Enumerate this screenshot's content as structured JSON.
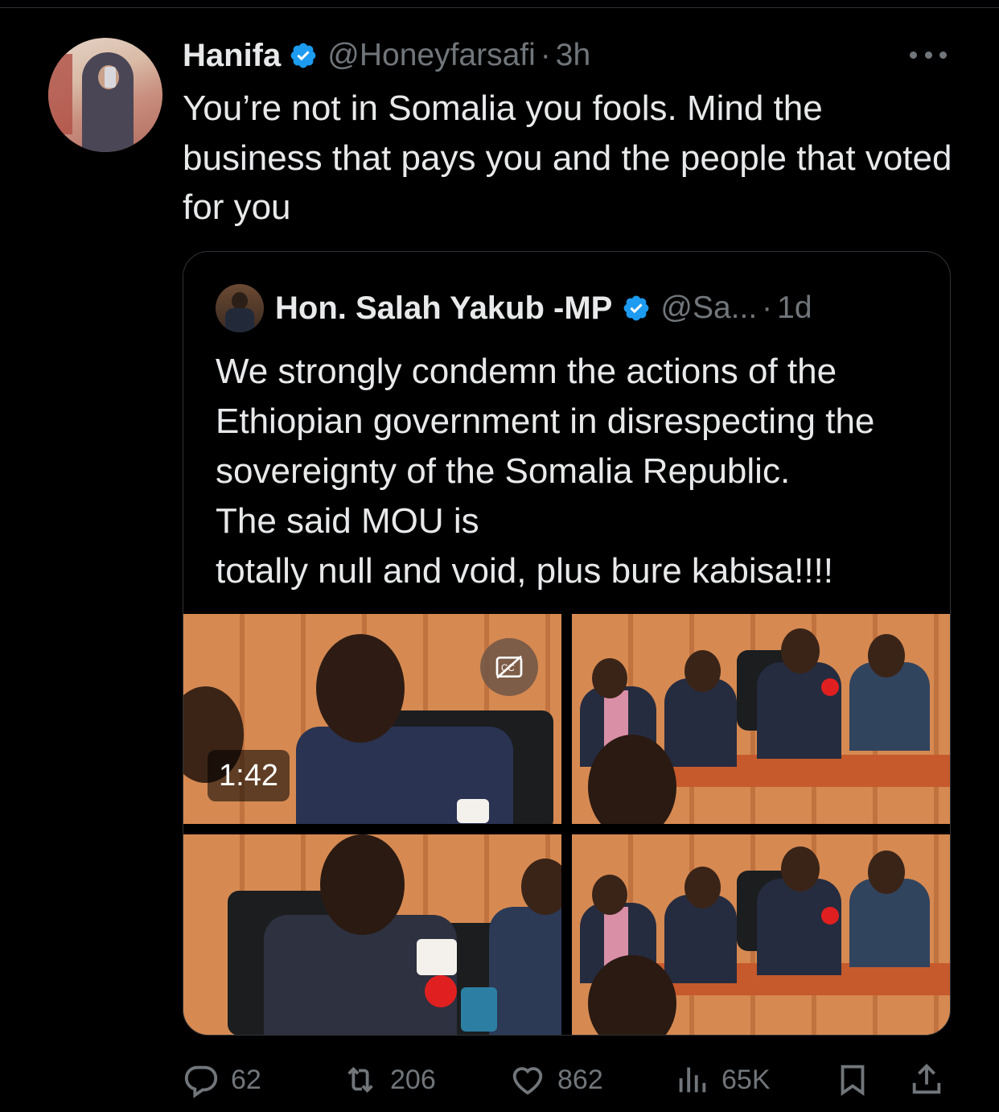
{
  "tweet": {
    "author_name": "Hanifa",
    "handle": "@Honeyfarsafi",
    "separator": "·",
    "time": "3h",
    "text": "You’re not in Somalia you fools. Mind the business that pays you and the people that voted for you",
    "avatar_icon": "user-avatar-photo",
    "verified_icon": "verified-badge-icon",
    "more_icon": "more-options-icon"
  },
  "quoted_tweet": {
    "author_name": "Hon. Salah Yakub -MP",
    "handle": "@Sa...",
    "separator": "·",
    "time": "1d",
    "text": "We strongly condemn the actions of the Ethiopian government in disrespecting the sovereignty of the Somalia Republic.\nThe said  MOU is\ntotally null and void, plus bure kabisa!!!!",
    "video_duration": "1:42",
    "captions_icon": "captions-off-icon"
  },
  "actions": {
    "replies": "62",
    "reposts": "206",
    "likes": "862",
    "views": "65K"
  },
  "colors": {
    "background": "#000000",
    "text": "#e7e9ea",
    "secondary": "#71767b",
    "verified": "#1d9bf0",
    "border": "#2f3336"
  }
}
